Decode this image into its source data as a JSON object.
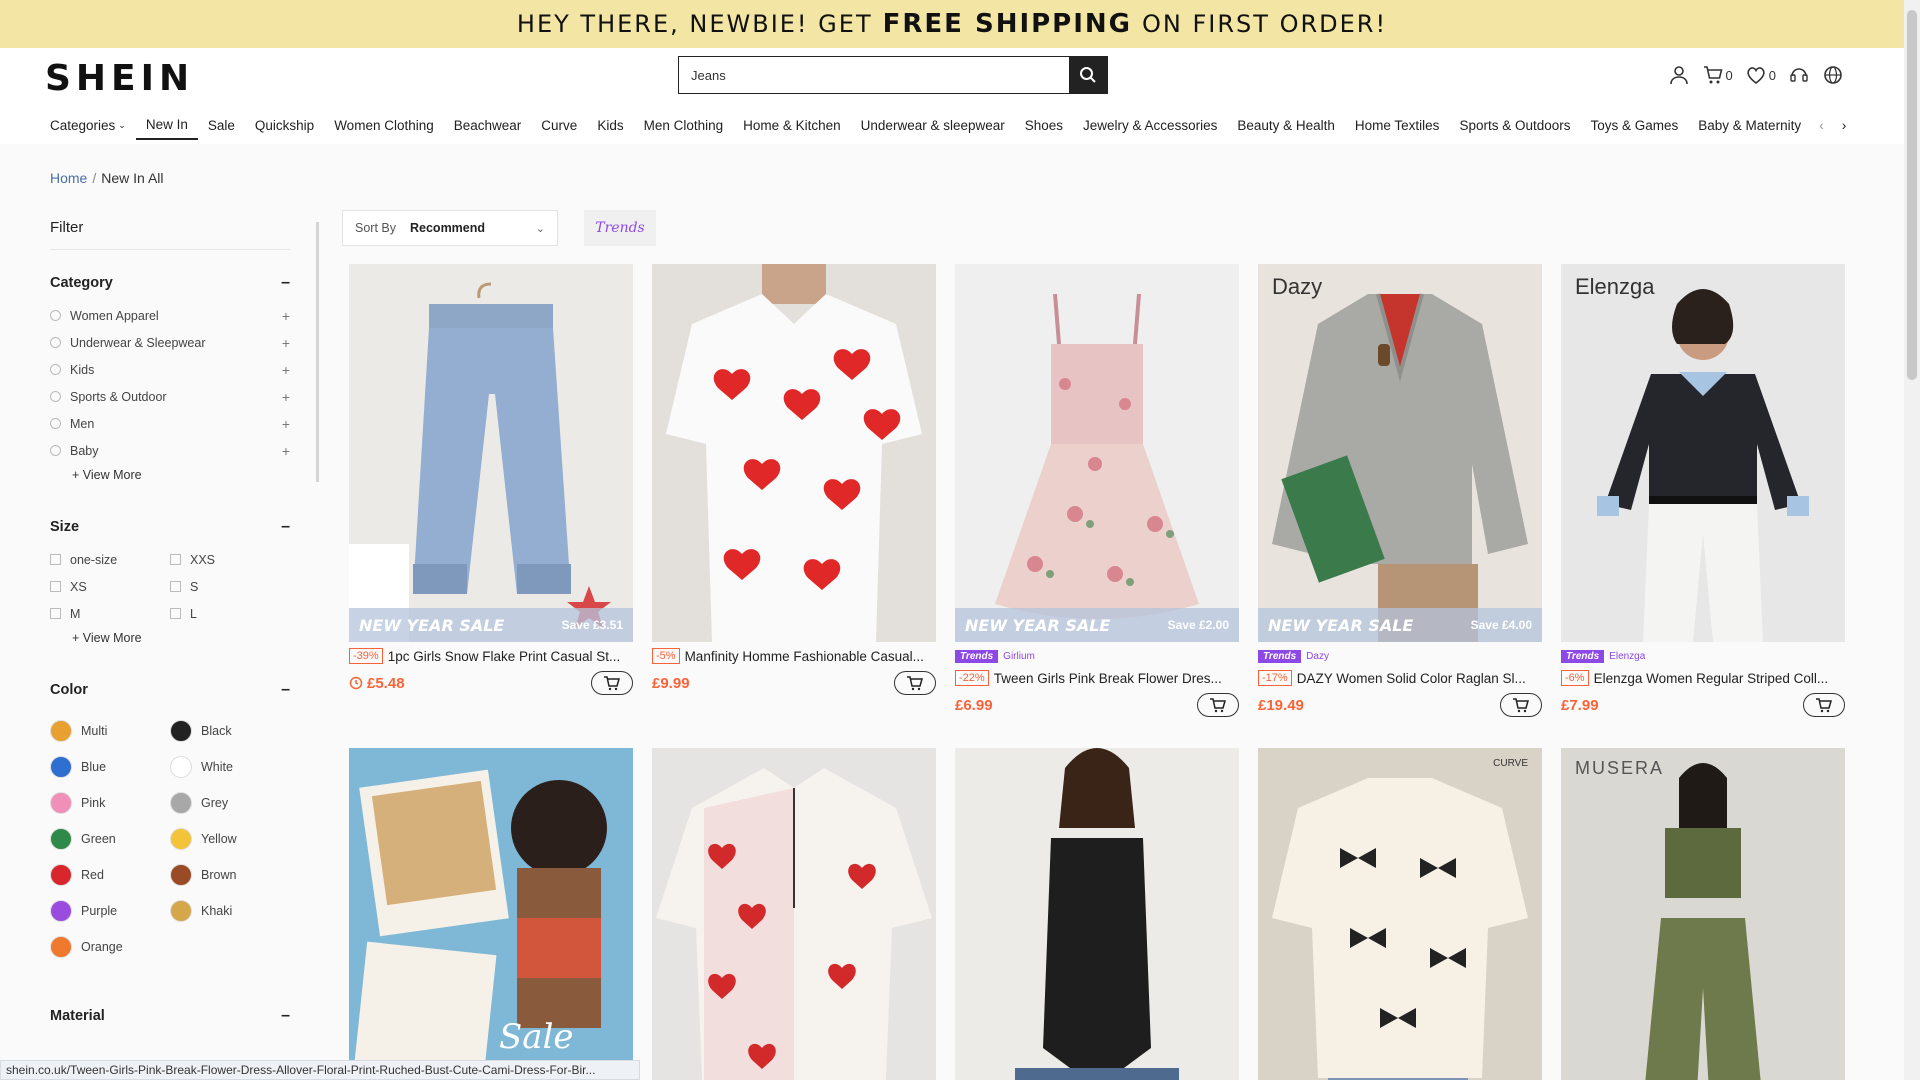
{
  "promo": {
    "text_pre": "HEY THERE, NEWBIE! GET",
    "text_bold": "FREE SHIPPING",
    "text_post": "ON FIRST ORDER!"
  },
  "header": {
    "logo": "SHEIN",
    "search_value": "Jeans",
    "cart_count": "0",
    "wishlist_count": "0"
  },
  "nav": {
    "items": [
      "Categories",
      "New In",
      "Sale",
      "Quickship",
      "Women Clothing",
      "Beachwear",
      "Curve",
      "Kids",
      "Men Clothing",
      "Home & Kitchen",
      "Underwear & sleepwear",
      "Shoes",
      "Jewelry & Accessories",
      "Beauty & Health",
      "Home Textiles",
      "Sports & Outdoors",
      "Toys & Games",
      "Baby & Maternity"
    ],
    "active": "New In"
  },
  "breadcrumb": {
    "home": "Home",
    "separator": "/",
    "current": "New In All"
  },
  "sidebar": {
    "filter_title": "Filter",
    "category": {
      "title": "Category",
      "items": [
        "Women Apparel",
        "Underwear & Sleepwear",
        "Kids",
        "Sports & Outdoor",
        "Men",
        "Baby"
      ],
      "view_more": "+ View More"
    },
    "size": {
      "title": "Size",
      "items": [
        "one-size",
        "XXS",
        "XS",
        "S",
        "M",
        "L"
      ],
      "view_more": "+ View More"
    },
    "color": {
      "title": "Color",
      "items": [
        {
          "name": "Multi",
          "hex": "#e8a030"
        },
        {
          "name": "Black",
          "hex": "#222222"
        },
        {
          "name": "Blue",
          "hex": "#2f6fd0"
        },
        {
          "name": "White",
          "hex": "#ffffff"
        },
        {
          "name": "Pink",
          "hex": "#f08fb8"
        },
        {
          "name": "Grey",
          "hex": "#a8a8a8"
        },
        {
          "name": "Green",
          "hex": "#2f8a4a"
        },
        {
          "name": "Yellow",
          "hex": "#f3c43a"
        },
        {
          "name": "Red",
          "hex": "#d8262c"
        },
        {
          "name": "Brown",
          "hex": "#9a4a25"
        },
        {
          "name": "Purple",
          "hex": "#9a4ce0"
        },
        {
          "name": "Khaki",
          "hex": "#d6a64a"
        },
        {
          "name": "Orange",
          "hex": "#ef7a2e"
        }
      ]
    },
    "material": {
      "title": "Material"
    }
  },
  "toolbar": {
    "sort_label": "Sort By",
    "sort_value": "Recommend",
    "trends_label": "Trends"
  },
  "products": [
    {
      "title": "1pc Girls Snow Flake Print Casual St...",
      "discount": "-39%",
      "price": "£5.48",
      "sale_banner": "NEW YEAR SALE",
      "save": "Save £3.51",
      "trends": false,
      "store": "",
      "brand_mark": "",
      "timer": true
    },
    {
      "title": "Manfinity Homme Fashionable Casual...",
      "discount": "-5%",
      "price": "£9.99",
      "sale_banner": "",
      "save": "",
      "trends": false,
      "store": "",
      "brand_mark": "",
      "timer": false
    },
    {
      "title": "Tween Girls Pink Break Flower Dres...",
      "discount": "-22%",
      "price": "£6.99",
      "sale_banner": "NEW YEAR SALE",
      "save": "Save £2.00",
      "trends": true,
      "store": "Girlium",
      "brand_mark": "",
      "timer": false
    },
    {
      "title": "DAZY Women Solid Color Raglan Sl...",
      "discount": "-17%",
      "price": "£19.49",
      "sale_banner": "NEW YEAR SALE",
      "save": "Save £4.00",
      "trends": true,
      "store": "Dazy",
      "brand_mark": "Dazy",
      "timer": false
    },
    {
      "title": "Elenzga Women Regular Striped Coll...",
      "discount": "-6%",
      "price": "£7.99",
      "sale_banner": "",
      "save": "",
      "trends": true,
      "store": "Elenzga",
      "brand_mark": "Elenzga",
      "timer": false
    }
  ],
  "products_row2": [
    {
      "sale_overlay": "Sale WAVES",
      "brand_mark": ""
    },
    {
      "brand_mark": ""
    },
    {
      "brand_mark": ""
    },
    {
      "brand_mark": "CURVE"
    },
    {
      "brand_mark": "MUSERA"
    }
  ],
  "status_url": "shein.co.uk/Tween-Girls-Pink-Break-Flower-Dress-Allover-Floral-Print-Ruched-Bust-Cute-Cami-Dress-For-Bir..."
}
